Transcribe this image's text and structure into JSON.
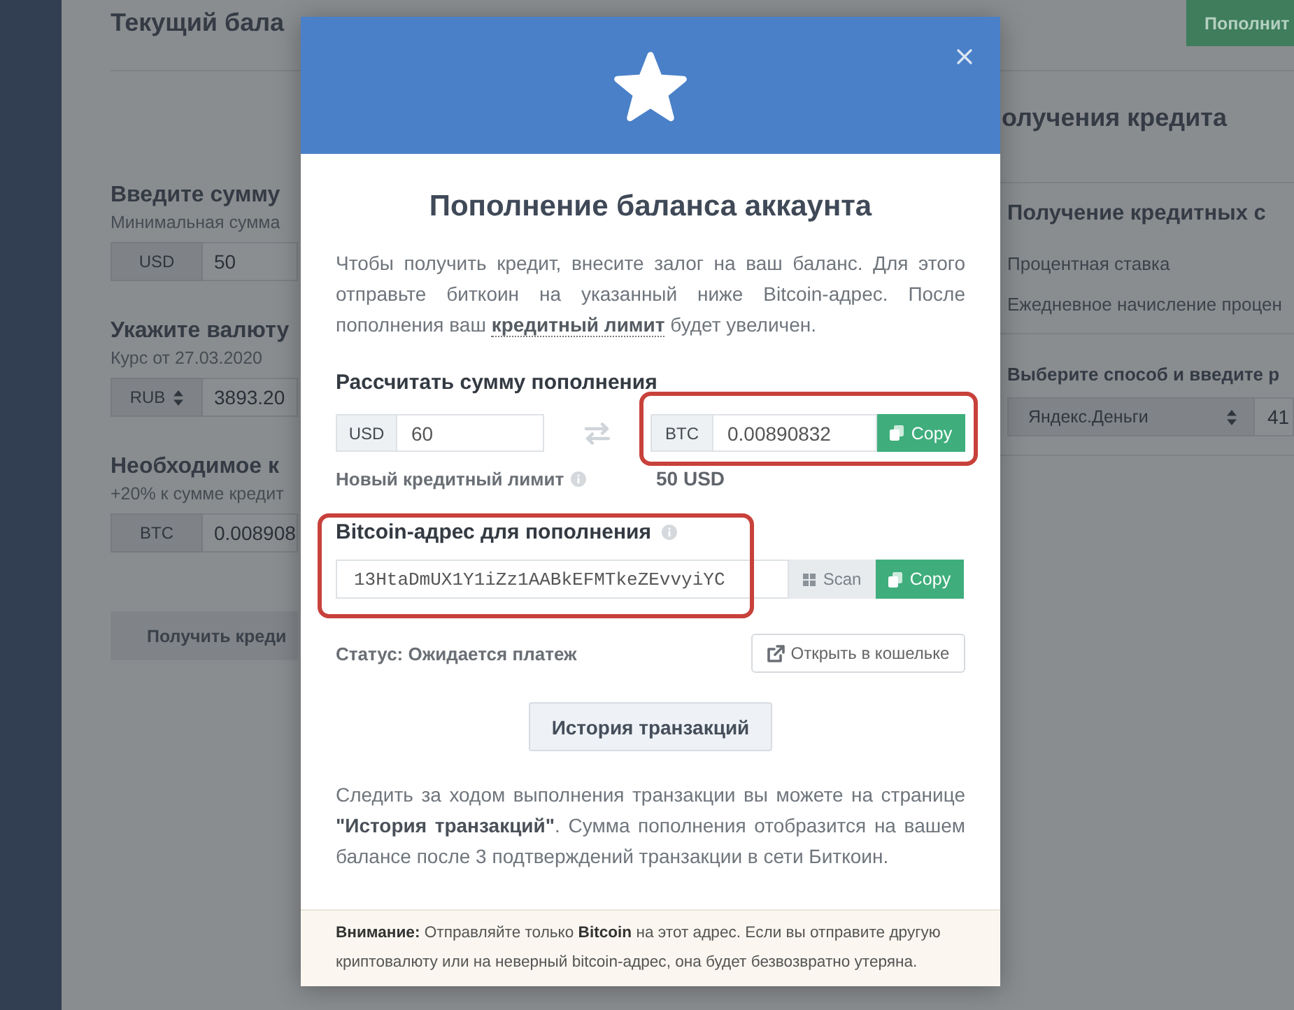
{
  "background_page": {
    "top_bar": {
      "title": "Текущий бала",
      "topup_button": "Пополнит"
    },
    "form": {
      "fields": [
        {
          "kind": "input",
          "label": "Введите сумму",
          "hint": "Минимальная сумма",
          "addon": "USD",
          "value": "50"
        },
        {
          "kind": "select",
          "label": "Укажите валюту",
          "hint": "Курс от 27.03.2020",
          "addon": "RUB",
          "value": "3893.20"
        },
        {
          "kind": "input",
          "label": "Необходимое к",
          "hint": "+20% к сумме кредит",
          "addon": "BTC",
          "value": "0.008908"
        }
      ],
      "submit_button": "Получить креди"
    },
    "credit_panel": {
      "title": "олучения кредита",
      "card_title": "Получение кредитных с",
      "rows": [
        "Процентная ставка",
        "Ежедневное начисление процен"
      ],
      "method_label": "Выберите способ и введите р",
      "method_select": "Яндекс.Деньги",
      "amount_value": "41"
    }
  },
  "modal": {
    "title": "Пополнение баланса аккаунта",
    "intro": "Чтобы получить кредит, внесите залог на ваш баланс. Для этого отправьте биткоин на указанный ниже Bitcoin-адрес. После пополнения ваш **кредитный лимит** будет увеличен.",
    "calculator": {
      "heading": "Рассчитать сумму пополнения",
      "from": {
        "currency": "USD",
        "value": "60"
      },
      "to": {
        "currency": "BTC",
        "value": "0.00890832",
        "copy_button": "Copy"
      },
      "highlighted": true,
      "limit_label": "Новый кредитный лимит",
      "limit_value": "50 USD"
    },
    "address": {
      "heading": "Bitcoin-адрес для пополнения",
      "value": "13HtaDmUX1Y1iZz1AABkEFMTkeZEvvyiYC",
      "scan_button": "Scan",
      "copy_button": "Copy",
      "highlighted": true
    },
    "status": "Статус: Ожидается платеж",
    "wallet_button": "Открыть в кошельке",
    "history_button": "История транзакций",
    "note": "Следить за ходом выполнения транзакции вы можете на странице **\"История транзакций\"**. Сумма пополнения отобразится на вашем балансе после 3 подтверждений транзакции в сети Биткоин.",
    "warning": "**Внимание:** Отправляйте только **Bitcoin** на этот адрес. Если вы отправите другую криптовалюту или на неверный bitcoin-адрес, она будет безвозвратно утеряна."
  }
}
